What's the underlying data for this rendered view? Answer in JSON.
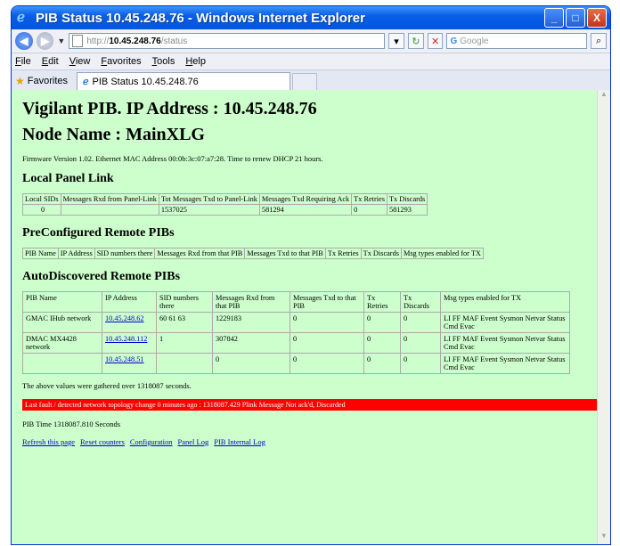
{
  "window": {
    "title": "PIB Status 10.45.248.76 - Windows Internet Explorer",
    "minimize": "_",
    "maximize": "□",
    "close": "X"
  },
  "address": {
    "prefix": "http://",
    "host": "10.45.248.76",
    "path": "/status",
    "search_placeholder": "Google"
  },
  "menu": [
    "File",
    "Edit",
    "View",
    "Favorites",
    "Tools",
    "Help"
  ],
  "favorites_label": "Favorites",
  "tab_label": "PIB Status 10.45.248.76",
  "page": {
    "heading": "Vigilant PIB. IP Address : 10.45.248.76",
    "node_name": "Node Name : MainXLG",
    "firmware": "Firmware Version 1.02. Ethernet MAC Address 00:0b:3c:07:a7:28. Time to renew DHCP 21 hours.",
    "local_panel": {
      "title": "Local Panel Link",
      "headers": [
        "Local SIDs",
        "Messages Rxd from Panel-Link",
        "Tot Messages Txd to Panel-Link",
        "Messages Txd Requiring Ack",
        "Tx Retries",
        "Tx Discards"
      ],
      "row": [
        "0",
        "",
        "1537025",
        "581294",
        "0",
        "581293"
      ]
    },
    "preconfigured": {
      "title": "PreConfigured Remote PIBs",
      "headers": [
        "PIB Name",
        "IP Address",
        "SID numbers there",
        "Messages Rxd from that PIB",
        "Messages Txd to that PIB",
        "Tx Retries",
        "Tx Discards",
        "Msg types enabled for TX"
      ]
    },
    "autodiscovered": {
      "title": "AutoDiscovered Remote PIBs",
      "headers": [
        "PIB Name",
        "IP Address",
        "SID numbers there",
        "Messages Rxd from that PIB",
        "Messages Txd to that PIB",
        "Tx Retries",
        "Tx Discards",
        "Msg types enabled for TX"
      ],
      "rows": [
        {
          "name": "GMAC  IHub network",
          "ip": "10.45.248.62",
          "sids": "60 61 63",
          "rxd": "1229183",
          "txd": "0",
          "retries": "0",
          "discards": "0",
          "types": "LI FF MAF Event Sysmon Netvar Status Cmd Evac"
        },
        {
          "name": "DMAC MX4428 network",
          "ip": "10.45.248.112",
          "sids": "1",
          "rxd": "307842",
          "txd": "0",
          "retries": "0",
          "discards": "0",
          "types": "LI FF MAF Event Sysmon Netvar Status Cmd Evac"
        },
        {
          "name": "",
          "ip": "10.45.248.51",
          "sids": "",
          "rxd": "0",
          "txd": "0",
          "retries": "0",
          "discards": "0",
          "types": "LI FF MAF Event Sysmon Netvar Status Cmd Evac"
        }
      ]
    },
    "gathered_note": "The above values were gathered over 1318087 seconds.",
    "fault": "Last fault / detected network topology change 0 minutes ago : 1318087.429 Plink Message Not ack'd, Discarded",
    "pib_time": "PIB Time 1318087.810 Seconds",
    "links": [
      "Refresh this page",
      "Reset counters",
      "Configuration",
      "Panel Log",
      "PIB Internal Log"
    ]
  },
  "colors": {
    "page_bg": "#ccffcc",
    "fault_bg": "#ff0000",
    "link": "#0000cc",
    "titlebar": "#0054e3"
  }
}
